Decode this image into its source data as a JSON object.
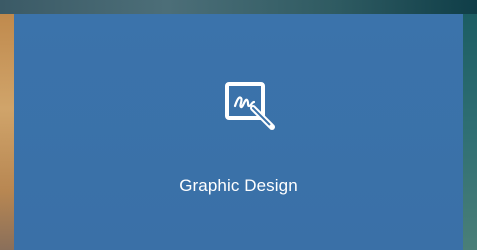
{
  "card": {
    "label": "Graphic Design",
    "icon": "graphic-design-icon",
    "background_color": "#3a72aa",
    "text_color": "#ffffff"
  }
}
